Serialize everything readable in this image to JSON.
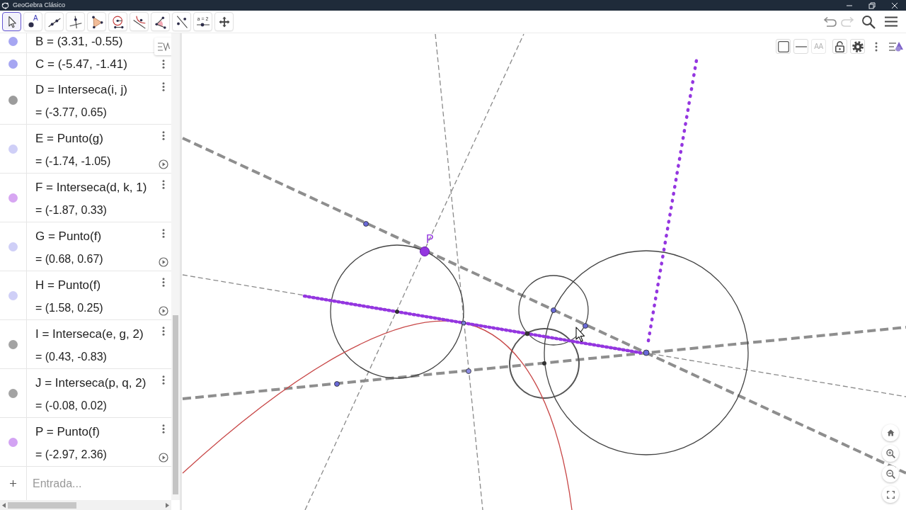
{
  "window": {
    "title": "GeoGebra Clásico"
  },
  "toolbar": {
    "tools": [
      {
        "kind": "move",
        "selected": true
      },
      {
        "kind": "point",
        "label": "A",
        "selected": false
      },
      {
        "kind": "line",
        "selected": false
      },
      {
        "kind": "perpendicular",
        "selected": false
      },
      {
        "kind": "polygon",
        "selected": false
      },
      {
        "kind": "circle",
        "selected": false
      },
      {
        "kind": "tangent",
        "selected": false
      },
      {
        "kind": "angle",
        "selected": false
      },
      {
        "kind": "reflect",
        "selected": false
      },
      {
        "kind": "slider",
        "label": "a = 2",
        "selected": false
      },
      {
        "kind": "move-view",
        "selected": false
      }
    ],
    "undo": {
      "disabled": false
    },
    "redo": {
      "disabled": true
    }
  },
  "algebra_view": {
    "items": [
      {
        "definition": "B = (3.31, -0.55)",
        "color": "#a6a6f2",
        "more_button": false,
        "play_button": false
      },
      {
        "definition": "C = (-5.47, -1.41)",
        "color": "#a6a6f2",
        "more_button": true,
        "play_button": false
      },
      {
        "definition": "D = Interseca(i, j)",
        "value": "= (-3.77, 0.65)",
        "color": "#9c9c9c",
        "more_button": true,
        "play_button": false
      },
      {
        "definition": "E = Punto(g)",
        "value": "= (-1.74, -1.05)",
        "color": "#cfcff7",
        "more_button": true,
        "play_button": true
      },
      {
        "definition": "F = Interseca(d, k, 1)",
        "value": "= (-1.87, 0.33)",
        "color": "#d7a6f2",
        "more_button": true,
        "play_button": false
      },
      {
        "definition": "G = Punto(f)",
        "value": "= (0.68, 0.67)",
        "color": "#cfcff7",
        "more_button": true,
        "play_button": true
      },
      {
        "definition": "H = Punto(f)",
        "value": "= (1.58, 0.25)",
        "color": "#cfcff7",
        "more_button": true,
        "play_button": true
      },
      {
        "definition": "I = Interseca(e, g, 2)",
        "value": "= (0.43, -0.83)",
        "color": "#a3a3a3",
        "more_button": true,
        "play_button": false
      },
      {
        "definition": "J = Interseca(p, q, 2)",
        "value": "= (-0.08, 0.02)",
        "color": "#a3a3a3",
        "more_button": true,
        "play_button": false
      },
      {
        "definition": "P = Punto(f)",
        "value": "= (-2.97, 2.36)",
        "color": "#d3a3f3",
        "more_button": true,
        "play_button": true
      }
    ],
    "input": {
      "placeholder": "Entrada..."
    }
  },
  "graphics_view": {
    "point_label": "P",
    "style_bar": [
      {
        "kind": "color",
        "disabled": false
      },
      {
        "kind": "line-style",
        "disabled": false
      },
      {
        "kind": "text-size",
        "label": "AA",
        "disabled": true
      },
      {
        "kind": "lock",
        "disabled": false
      },
      {
        "kind": "settings",
        "disabled": false
      }
    ]
  }
}
